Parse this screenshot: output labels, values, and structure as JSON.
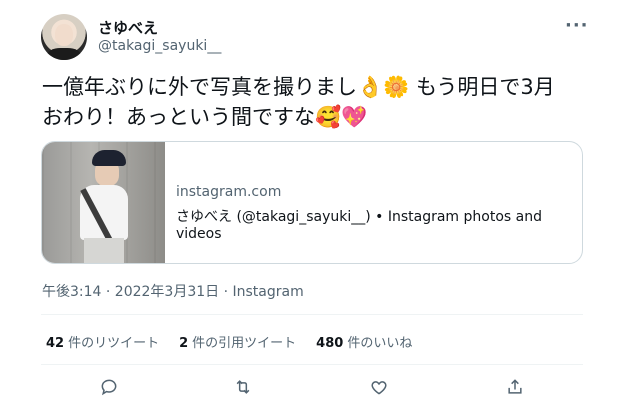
{
  "user": {
    "display_name": "さゆべえ",
    "handle": "@takagi_sayuki__"
  },
  "more_icon": "more-horizontal-icon",
  "tweet": {
    "line1": "一億年ぶりに外で写真を撮りまし",
    "line1_after_emoji": "もう明日で3月",
    "line2": "おわり！あっという間ですな",
    "emojis": [
      "👌",
      "🌼",
      "🥰",
      "💖"
    ]
  },
  "card": {
    "domain": "instagram.com",
    "title": "さゆべえ (@takagi_sayuki__) • Instagram photos and videos"
  },
  "meta": "午後3:14 · 2022年3月31日 · Instagram",
  "stats": [
    {
      "num": "42",
      "label": "件のリツイート"
    },
    {
      "num": "2",
      "label": "件の引用ツイート"
    },
    {
      "num": "480",
      "label": "件のいいね"
    }
  ],
  "actions": [
    "reply-icon",
    "retweet-icon",
    "like-icon",
    "share-icon"
  ],
  "colors": {
    "text": "#0f1419",
    "secondary": "#536471",
    "border": "#cfd9de"
  }
}
